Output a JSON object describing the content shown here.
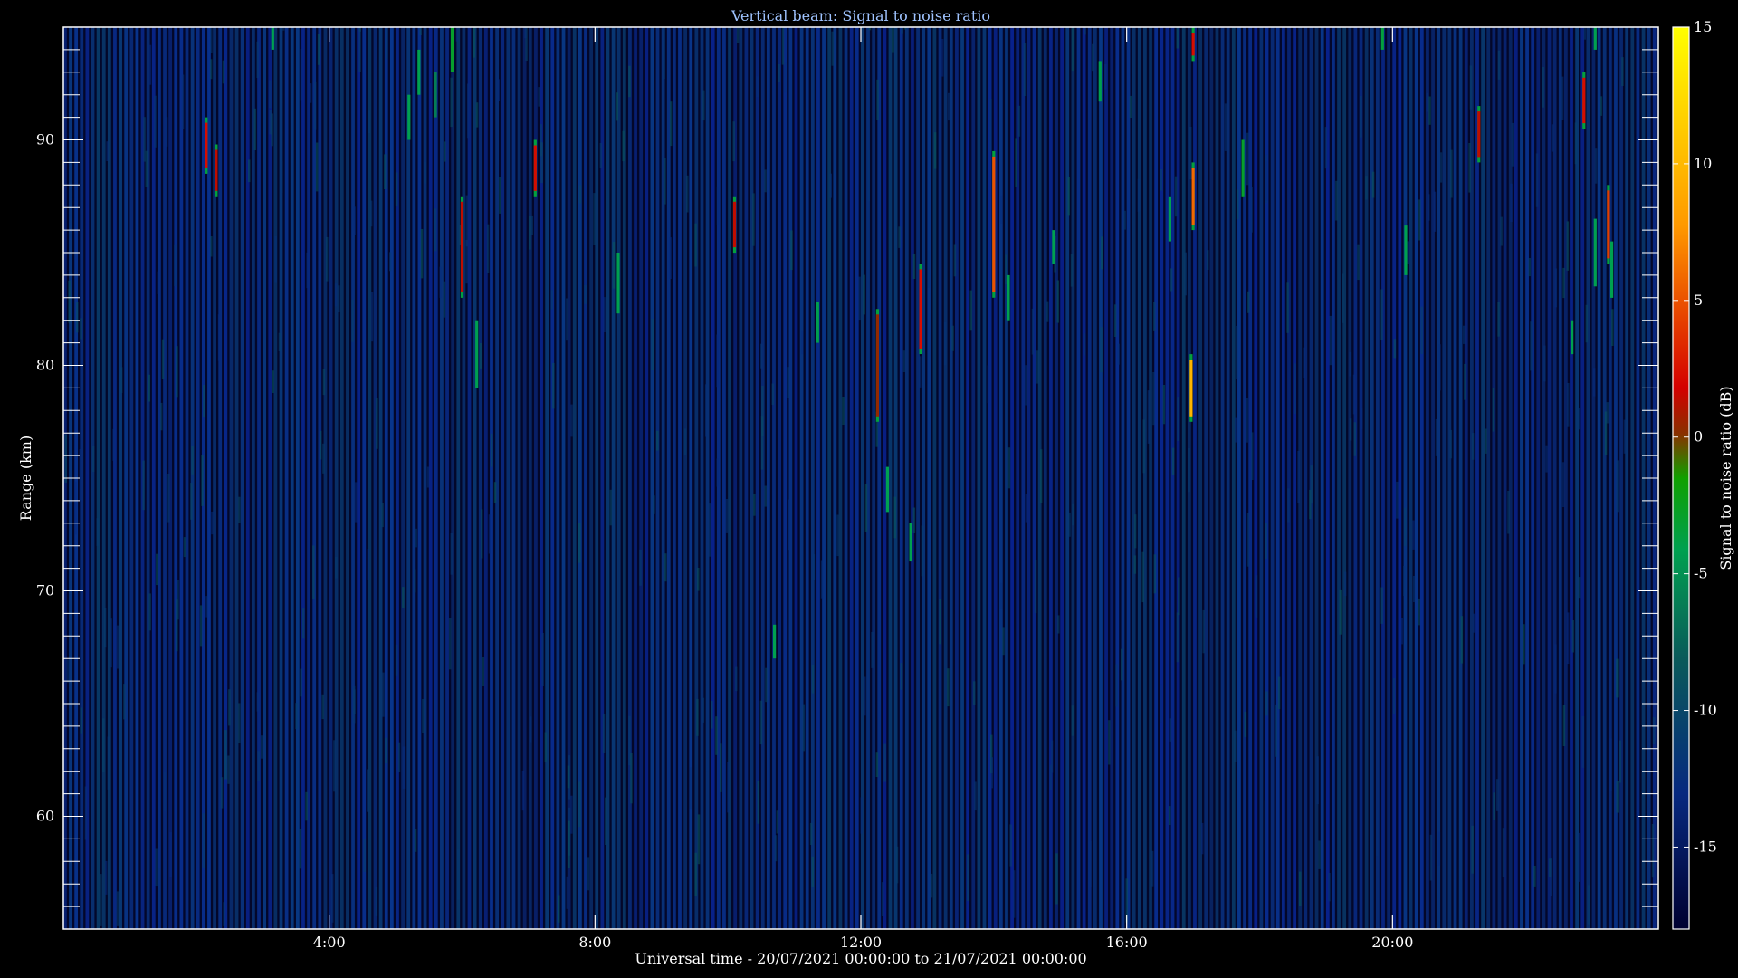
{
  "chart_data": {
    "type": "heatmap",
    "title": "Vertical beam: Signal to noise ratio",
    "xlabel": "Universal time - 20/07/2021 00:00:00 to 21/07/2021 00:00:00",
    "ylabel": "Range (km)",
    "colorbar_label": "Signal to noise ratio (dB)",
    "x_range_hours": [
      0,
      24
    ],
    "y_range_km": [
      55,
      95
    ],
    "x_ticks": [
      {
        "value": 4,
        "label": "4:00"
      },
      {
        "value": 8,
        "label": "8:00"
      },
      {
        "value": 12,
        "label": "12:00"
      },
      {
        "value": 16,
        "label": "16:00"
      },
      {
        "value": 20,
        "label": "20:00"
      }
    ],
    "y_ticks": [
      {
        "value": 60,
        "label": "60"
      },
      {
        "value": 70,
        "label": "70"
      },
      {
        "value": 80,
        "label": "80"
      },
      {
        "value": 90,
        "label": "90"
      }
    ],
    "colorbar_range_db": [
      -18,
      15
    ],
    "colorbar_ticks": [
      {
        "value": 15,
        "label": "15"
      },
      {
        "value": 10,
        "label": "10"
      },
      {
        "value": 5,
        "label": "5"
      },
      {
        "value": 0,
        "label": "0"
      },
      {
        "value": -5,
        "label": "-5"
      },
      {
        "value": -10,
        "label": "-10"
      },
      {
        "value": -15,
        "label": "-15"
      }
    ],
    "colormap": [
      "#000030",
      "#082a86",
      "#00aa55",
      "#00b000",
      "#d40000",
      "#ff9900",
      "#ffff00"
    ],
    "background_db": -16,
    "echoes": [
      {
        "t": 2.15,
        "r0": 88.5,
        "r1": 91.0,
        "db": 2
      },
      {
        "t": 2.3,
        "r0": 87.5,
        "r1": 89.8,
        "db": 1
      },
      {
        "t": 3.15,
        "r0": 94.0,
        "r1": 95.0,
        "db": -6
      },
      {
        "t": 5.2,
        "r0": 90.0,
        "r1": 92.0,
        "db": -6
      },
      {
        "t": 5.35,
        "r0": 92.0,
        "r1": 94.0,
        "db": -6
      },
      {
        "t": 5.6,
        "r0": 91.0,
        "r1": 93.0,
        "db": -7
      },
      {
        "t": 5.85,
        "r0": 93.0,
        "r1": 95.0,
        "db": -4
      },
      {
        "t": 6.0,
        "r0": 83.0,
        "r1": 87.5,
        "db": 1
      },
      {
        "t": 6.22,
        "r0": 79.0,
        "r1": 82.0,
        "db": -6
      },
      {
        "t": 7.1,
        "r0": 87.5,
        "r1": 90.0,
        "db": 2
      },
      {
        "t": 8.35,
        "r0": 82.3,
        "r1": 85.0,
        "db": -6
      },
      {
        "t": 10.1,
        "r0": 85.0,
        "r1": 87.5,
        "db": 1
      },
      {
        "t": 10.7,
        "r0": 67.0,
        "r1": 68.5,
        "db": -6
      },
      {
        "t": 11.35,
        "r0": 81.0,
        "r1": 82.8,
        "db": -6
      },
      {
        "t": 12.25,
        "r0": 77.5,
        "r1": 82.5,
        "db": 0
      },
      {
        "t": 12.4,
        "r0": 73.5,
        "r1": 75.5,
        "db": -6
      },
      {
        "t": 12.75,
        "r0": 71.3,
        "r1": 73.0,
        "db": -6
      },
      {
        "t": 12.9,
        "r0": 80.5,
        "r1": 84.5,
        "db": 2
      },
      {
        "t": 14.0,
        "r0": 83.0,
        "r1": 89.5,
        "db": 5
      },
      {
        "t": 14.22,
        "r0": 82.0,
        "r1": 84.0,
        "db": -6
      },
      {
        "t": 14.9,
        "r0": 84.5,
        "r1": 86.0,
        "db": -6
      },
      {
        "t": 15.6,
        "r0": 91.7,
        "r1": 93.5,
        "db": -6
      },
      {
        "t": 16.65,
        "r0": 85.5,
        "r1": 87.5,
        "db": -6
      },
      {
        "t": 17.0,
        "r0": 93.5,
        "r1": 95.0,
        "db": 2
      },
      {
        "t": 17.0,
        "r0": 86.0,
        "r1": 89.0,
        "db": 6
      },
      {
        "t": 16.97,
        "r0": 77.5,
        "r1": 80.5,
        "db": 10
      },
      {
        "t": 17.75,
        "r0": 87.5,
        "r1": 90.0,
        "db": -4
      },
      {
        "t": 19.85,
        "r0": 94.0,
        "r1": 95.0,
        "db": -5
      },
      {
        "t": 20.2,
        "r0": 84.0,
        "r1": 86.2,
        "db": -6
      },
      {
        "t": 21.3,
        "r0": 89.0,
        "r1": 91.5,
        "db": 1
      },
      {
        "t": 22.7,
        "r0": 80.5,
        "r1": 82.0,
        "db": -6
      },
      {
        "t": 22.88,
        "r0": 90.5,
        "r1": 93.0,
        "db": 2
      },
      {
        "t": 23.05,
        "r0": 94.0,
        "r1": 95.0,
        "db": -6
      },
      {
        "t": 23.05,
        "r0": 83.5,
        "r1": 86.5,
        "db": -6
      },
      {
        "t": 23.25,
        "r0": 84.5,
        "r1": 88.0,
        "db": 4
      },
      {
        "t": 23.3,
        "r0": 83.0,
        "r1": 85.5,
        "db": -6
      }
    ]
  }
}
